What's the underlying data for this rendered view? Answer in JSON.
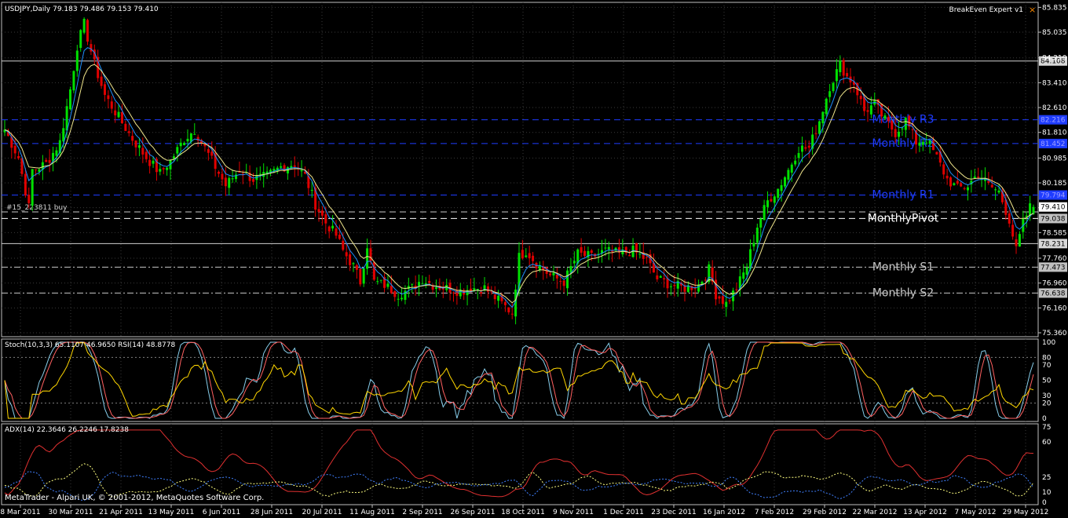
{
  "header": {
    "symbol_info": "USDJPY,Daily  79.183 79.486 79.153 79.410",
    "expert": "BreakEven Expert v1",
    "close_glyph": "×"
  },
  "footer": {
    "copyright": "MetaTrader - Alpari UK, © 2001-2012, MetaQuotes Software Corp."
  },
  "colors": {
    "background": "#000000",
    "frame": "#c0c0c0",
    "grid": "#3a3a3a",
    "bull": "#00e000",
    "bear": "#e00000",
    "ma_fast": "#1e90ff",
    "ma_slow": "#f0e68c",
    "resistance": "#1e3cff",
    "pivot": "#ffffff",
    "support": "#c8c8c8",
    "stoch_main": "#87ceeb",
    "stoch_signal": "#ff6060",
    "rsi": "#ffd700",
    "adx": "#e03030",
    "plus_di": "#ffff80",
    "minus_di": "#4080ff"
  },
  "chart_data": [
    {
      "type": "candlestick",
      "symbol": "USDJPY",
      "timeframe": "Daily",
      "ohlc_last": {
        "open": 79.183,
        "high": 79.486,
        "low": 79.153,
        "close": 79.41
      },
      "ylim": [
        75.36,
        85.87
      ],
      "y_ticks": [
        "85.835",
        "85.035",
        "84.210",
        "83.410",
        "82.610",
        "81.810",
        "80.985",
        "80.185",
        "79.385",
        "78.585",
        "77.760",
        "76.960",
        "76.160",
        "75.360"
      ],
      "x_ticks": [
        "8 Mar 2011",
        "30 Mar 2011",
        "21 Apr 2011",
        "13 May 2011",
        "6 Jun 2011",
        "28 Jun 2011",
        "20 Jul 2011",
        "11 Aug 2011",
        "2 Sep 2011",
        "26 Sep 2011",
        "18 Oct 2011",
        "9 Nov 2011",
        "1 Dec 2011",
        "23 Dec 2011",
        "16 Jan 2012",
        "7 Feb 2012",
        "29 Feb 2012",
        "22 Mar 2012",
        "13 Apr 2012",
        "7 May 2012",
        "29 May 2012"
      ],
      "close_anchors": [
        [
          0,
          81.9
        ],
        [
          4,
          81.0
        ],
        [
          7,
          79.4
        ],
        [
          8,
          80.6
        ],
        [
          12,
          80.8
        ],
        [
          16,
          81.5
        ],
        [
          19,
          83.2
        ],
        [
          21,
          84.6
        ],
        [
          23,
          85.3
        ],
        [
          26,
          84.0
        ],
        [
          29,
          83.0
        ],
        [
          33,
          82.3
        ],
        [
          37,
          81.6
        ],
        [
          41,
          81.0
        ],
        [
          45,
          80.5
        ],
        [
          48,
          80.9
        ],
        [
          52,
          81.6
        ],
        [
          55,
          81.9
        ],
        [
          58,
          81.3
        ],
        [
          61,
          80.7
        ],
        [
          64,
          80.1
        ],
        [
          68,
          80.6
        ],
        [
          72,
          80.3
        ],
        [
          76,
          80.4
        ],
        [
          80,
          80.7
        ],
        [
          84,
          80.8
        ],
        [
          87,
          80.4
        ],
        [
          90,
          79.5
        ],
        [
          93,
          78.9
        ],
        [
          96,
          78.5
        ],
        [
          98,
          78.0
        ],
        [
          101,
          77.5
        ],
        [
          103,
          77.0
        ],
        [
          105,
          78.2
        ],
        [
          107,
          77.0
        ],
        [
          110,
          76.9
        ],
        [
          114,
          76.6
        ],
        [
          118,
          76.8
        ],
        [
          121,
          77.1
        ],
        [
          124,
          76.9
        ],
        [
          128,
          76.8
        ],
        [
          132,
          76.7
        ],
        [
          135,
          76.8
        ],
        [
          139,
          76.8
        ],
        [
          143,
          76.4
        ],
        [
          147,
          76.0
        ],
        [
          149,
          77.8
        ],
        [
          151,
          78.0
        ],
        [
          154,
          77.6
        ],
        [
          158,
          77.2
        ],
        [
          162,
          77.0
        ],
        [
          166,
          77.9
        ],
        [
          170,
          77.8
        ],
        [
          174,
          78.0
        ],
        [
          178,
          77.9
        ],
        [
          182,
          78.0
        ],
        [
          186,
          77.7
        ],
        [
          189,
          77.1
        ],
        [
          193,
          76.9
        ],
        [
          197,
          76.8
        ],
        [
          201,
          76.9
        ],
        [
          204,
          77.4
        ],
        [
          206,
          76.6
        ],
        [
          209,
          76.3
        ],
        [
          212,
          76.8
        ],
        [
          215,
          77.5
        ],
        [
          218,
          78.8
        ],
        [
          221,
          79.6
        ],
        [
          224,
          80.0
        ],
        [
          227,
          80.6
        ],
        [
          230,
          81.3
        ],
        [
          233,
          81.3
        ],
        [
          236,
          82.2
        ],
        [
          239,
          83.3
        ],
        [
          242,
          84.0
        ],
        [
          244,
          83.6
        ],
        [
          246,
          83.4
        ],
        [
          249,
          82.5
        ],
        [
          252,
          82.7
        ],
        [
          255,
          82.2
        ],
        [
          258,
          81.8
        ],
        [
          261,
          82.2
        ],
        [
          264,
          81.5
        ],
        [
          267,
          81.6
        ],
        [
          270,
          81.0
        ],
        [
          273,
          80.3
        ],
        [
          276,
          80.0
        ],
        [
          279,
          80.1
        ],
        [
          282,
          80.5
        ],
        [
          285,
          80.1
        ],
        [
          288,
          79.9
        ],
        [
          291,
          79.0
        ],
        [
          293,
          78.0
        ],
        [
          295,
          78.9
        ],
        [
          297,
          79.4
        ],
        [
          298,
          79.41
        ]
      ],
      "levels": [
        {
          "label": "",
          "value": 84.108,
          "value_text": "84.108",
          "style": "solid"
        },
        {
          "label": "Monthly R3",
          "value": 82.216,
          "value_text": "82.216",
          "style": "dash"
        },
        {
          "label": "Monthly R2",
          "value": 81.452,
          "value_text": "81.452",
          "style": "dash"
        },
        {
          "label": "Monthly R1",
          "value": 79.794,
          "value_text": "79.794",
          "style": "dash"
        },
        {
          "label": "#15_223811 buy",
          "value": 79.25,
          "value_text": "",
          "style": "dash"
        },
        {
          "label": "MonthlyPivot",
          "value": 79.038,
          "value_text": "79.038",
          "style": "dash"
        },
        {
          "label": "",
          "value": 78.231,
          "value_text": "78.231",
          "style": "solid"
        },
        {
          "label": "Monthly S1",
          "value": 77.473,
          "value_text": "77.473",
          "style": "dashdot"
        },
        {
          "label": "Monthly S2",
          "value": 76.638,
          "value_text": "76.638",
          "style": "dashdot"
        }
      ],
      "current_price": {
        "value": 79.41,
        "text": "79.410"
      }
    },
    {
      "type": "line",
      "indicator": "Stoch(10,3,3) / RSI(14)",
      "label": "Stoch(10,3,3) 65.1107 46.9650  RSI(14) 48.8778",
      "ylim": [
        0,
        100
      ],
      "y_ticks": [
        "100",
        "80",
        "70",
        "50",
        "30",
        "20",
        "0"
      ],
      "series": [
        {
          "name": "Stoch %K",
          "last": 65.1107
        },
        {
          "name": "Stoch %D",
          "last": 46.965
        },
        {
          "name": "RSI(14)",
          "last": 48.8778
        }
      ]
    },
    {
      "type": "line",
      "indicator": "ADX(14)",
      "label": "ADX(14) 22.3646 26.2246 17.8238",
      "ylim": [
        0,
        75
      ],
      "y_ticks": [
        "75",
        "60",
        "25",
        "10",
        "0"
      ],
      "series": [
        {
          "name": "ADX",
          "last": 22.3646
        },
        {
          "name": "+DI",
          "last": 26.2246
        },
        {
          "name": "-DI",
          "last": 17.8238
        }
      ]
    }
  ]
}
